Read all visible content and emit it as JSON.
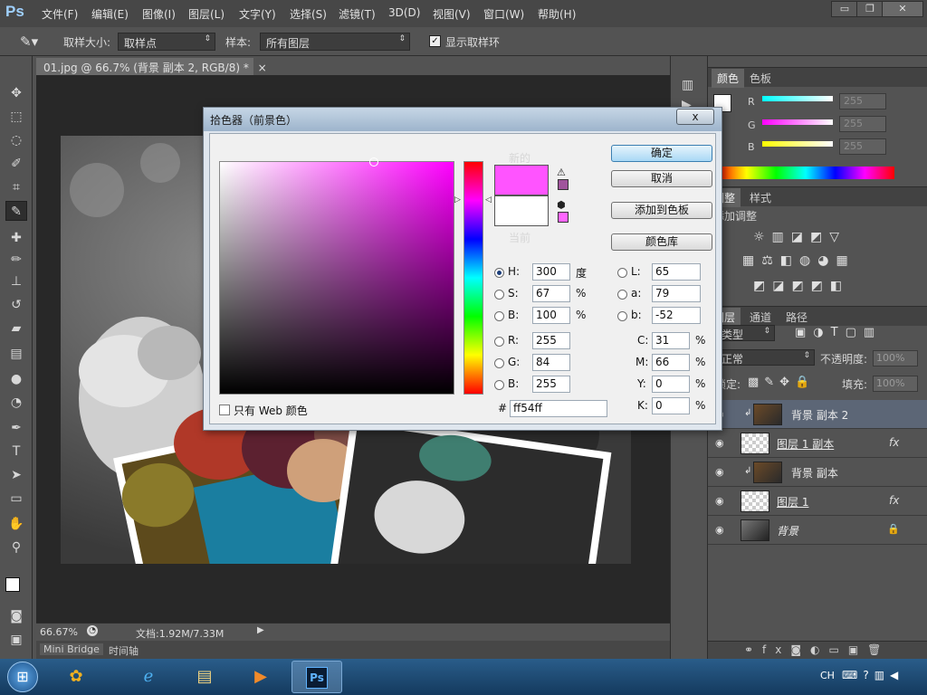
{
  "app": {
    "logo": "Ps"
  },
  "menu": [
    "文件(F)",
    "编辑(E)",
    "图像(I)",
    "图层(L)",
    "文字(Y)",
    "选择(S)",
    "滤镜(T)",
    "3D(D)",
    "视图(V)",
    "窗口(W)",
    "帮助(H)"
  ],
  "window_controls": {
    "minimize": "▭",
    "restore": "❐",
    "close": "✕"
  },
  "options_bar": {
    "sample_size_label": "取样大小:",
    "sample_size_value": "取样点",
    "sample_label": "样本:",
    "sample_value": "所有图层",
    "show_ring_label": "显示取样环",
    "show_ring_checked": true
  },
  "document": {
    "tab_title": "01.jpg @ 66.7% (背景 副本 2, RGB/8) *",
    "tab_close": "×",
    "zoom": "66.67%",
    "doc_info": "文档:1.92M/7.33M"
  },
  "bottom_tabs": [
    "Mini Bridge",
    "时间轴"
  ],
  "color_panel": {
    "tabs": [
      "颜色",
      "色板"
    ],
    "r_label": "R",
    "g_label": "G",
    "b_label": "B",
    "r_value": "255",
    "g_value": "255",
    "b_value": "255"
  },
  "adjustments_panel": {
    "tabs": [
      "调整",
      "样式"
    ],
    "title": "添加调整"
  },
  "layers_panel": {
    "tabs": [
      "图层",
      "通道",
      "路径"
    ],
    "filter_label": "类型",
    "blend_mode": "正常",
    "opacity_label": "不透明度:",
    "opacity_value": "100%",
    "lock_label": "锁定:",
    "fill_label": "填充:",
    "fill_value": "100%",
    "layers": [
      {
        "name": "背景 副本 2",
        "fx": "",
        "selected": true
      },
      {
        "name": "图层 1 副本",
        "fx": "fx",
        "selected": false
      },
      {
        "name": "背景 副本",
        "fx": "",
        "selected": false
      },
      {
        "name": "图层 1",
        "fx": "fx",
        "selected": false
      },
      {
        "name": "背景",
        "fx": "",
        "selected": false
      }
    ]
  },
  "color_picker": {
    "title": "拾色器（前景色）",
    "close": "x",
    "new_label": "新的",
    "current_label": "当前",
    "new_color": "#ff54ff",
    "current_color": "#ffffff",
    "buttons": {
      "ok": "确定",
      "cancel": "取消",
      "add_swatch": "添加到色板",
      "libraries": "颜色库"
    },
    "hsb": {
      "h_label": "H:",
      "h": "300",
      "h_unit": "度",
      "s_label": "S:",
      "s": "67",
      "s_unit": "%",
      "b_label": "B:",
      "b": "100",
      "b_unit": "%"
    },
    "lab": {
      "l_label": "L:",
      "l": "65",
      "a_label": "a:",
      "a": "79",
      "b_label": "b:",
      "b": "-52"
    },
    "rgb": {
      "r_label": "R:",
      "r": "255",
      "g_label": "G:",
      "g": "84",
      "b_label": "B:",
      "b": "255"
    },
    "cmyk": {
      "c_label": "C:",
      "c": "31",
      "m_label": "M:",
      "m": "66",
      "y_label": "Y:",
      "y": "0",
      "k_label": "K:",
      "k": "0",
      "unit": "%"
    },
    "hex_label": "#",
    "hex": "ff54ff",
    "web_only_label": "只有 Web 颜色"
  },
  "taskbar": {
    "lang": "CH"
  },
  "colors": {
    "accent": "#ff54ff",
    "panel_bg": "#535353",
    "dark_bg": "#282828"
  }
}
